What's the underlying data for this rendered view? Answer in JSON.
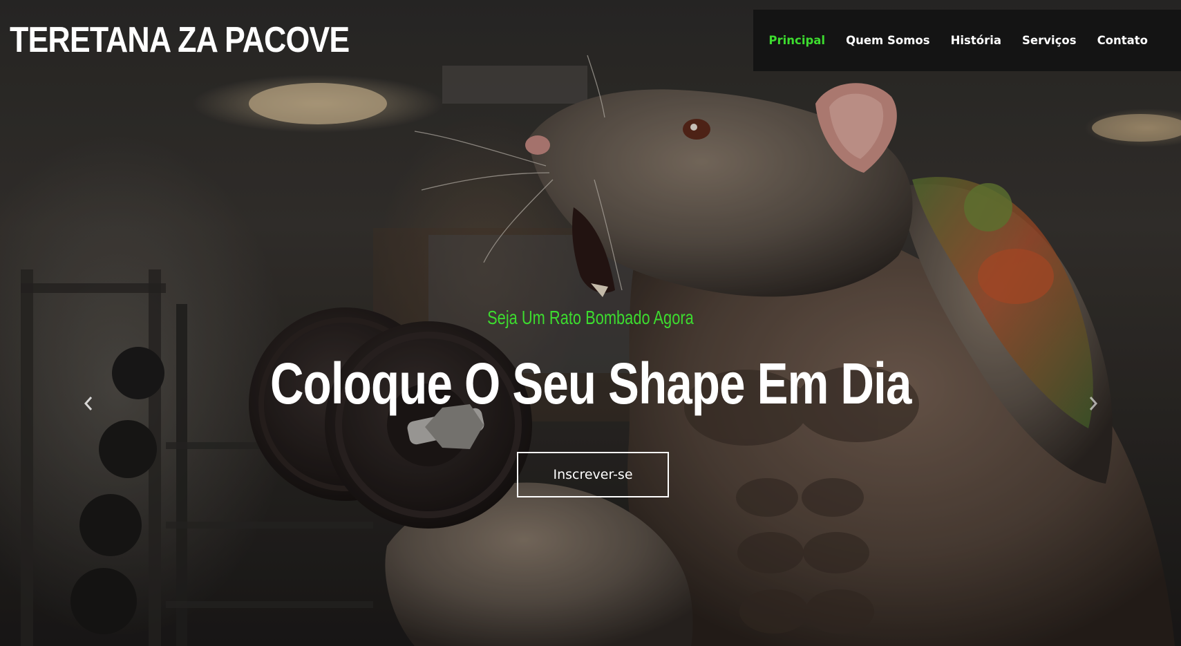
{
  "brand": {
    "title": "TERETANA ZA PACOVE"
  },
  "nav": {
    "items": [
      {
        "label": "Principal",
        "active": true
      },
      {
        "label": "Quem Somos",
        "active": false
      },
      {
        "label": "História",
        "active": false
      },
      {
        "label": "Serviços",
        "active": false
      },
      {
        "label": "Contato",
        "active": false
      }
    ]
  },
  "hero": {
    "tagline": "Seja Um Rato Bombado Agora",
    "headline": "Coloque O Seu Shape Em Dia",
    "cta_label": "Inscrever-se",
    "background_image": "muscular-rat-lifting-dumbbell-in-gym"
  },
  "carousel": {
    "prev_icon": "chevron-left-icon",
    "next_icon": "chevron-right-icon"
  },
  "colors": {
    "accent": "#3ddc2f",
    "nav_background": "#141414",
    "text": "#ffffff"
  }
}
